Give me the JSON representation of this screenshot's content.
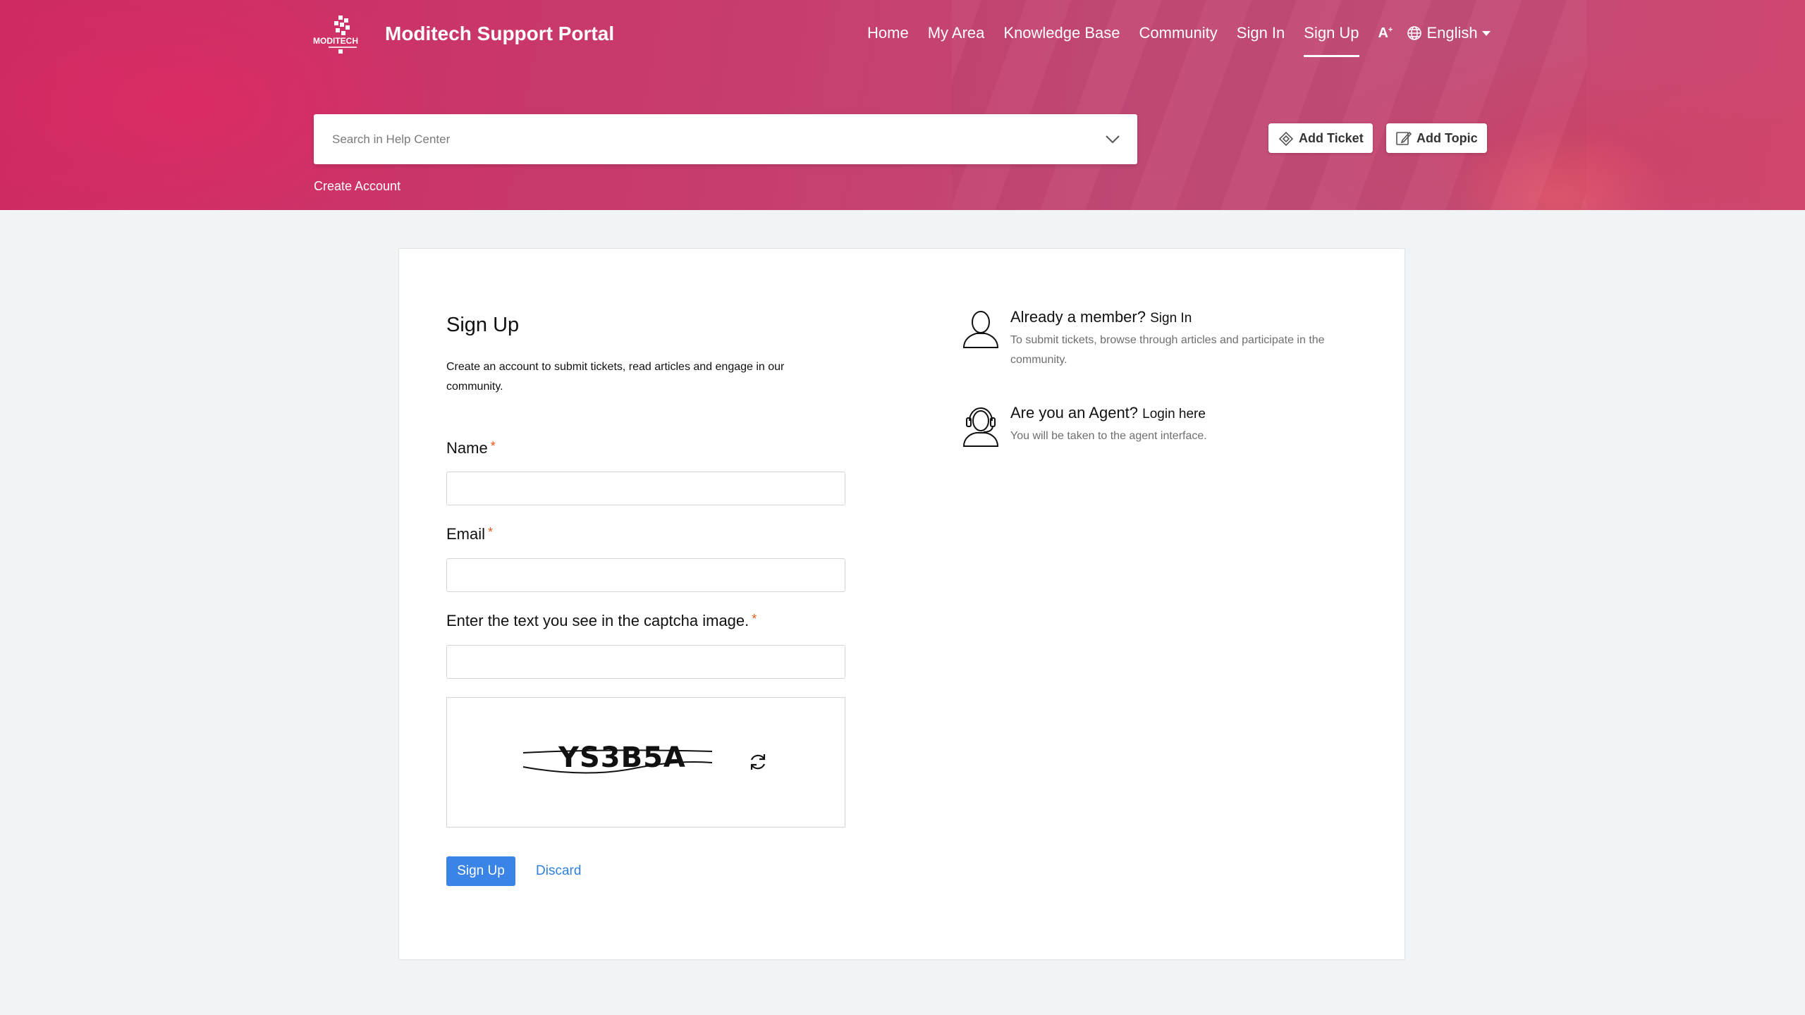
{
  "brand": {
    "title": "Moditech Support Portal",
    "logo_text": "MODITECH"
  },
  "nav": {
    "items": [
      {
        "label": "Home"
      },
      {
        "label": "My Area"
      },
      {
        "label": "Knowledge Base"
      },
      {
        "label": "Community"
      },
      {
        "label": "Sign In"
      },
      {
        "label": "Sign Up",
        "active": true
      }
    ],
    "font_icon": "A",
    "language": "English"
  },
  "search": {
    "placeholder": "Search in Help Center"
  },
  "actions": {
    "add_ticket": "Add Ticket",
    "add_topic": "Add Topic"
  },
  "create_account": "Create Account",
  "form": {
    "title": "Sign Up",
    "description": "Create an account to submit tickets, read articles and engage in our community.",
    "fields": [
      {
        "label": "Name",
        "required_mark": "*"
      },
      {
        "label": "Email",
        "required_mark": "*"
      },
      {
        "label": "Enter the text you see in the captcha image.",
        "required_mark": "*"
      }
    ],
    "captcha_text": "YS3B5A",
    "submit_label": "Sign Up",
    "discard_label": "Discard"
  },
  "info": {
    "member": {
      "title": "Already a member?",
      "link": "Sign In",
      "description": "To submit tickets, browse through articles and participate in the community."
    },
    "agent": {
      "title": "Are you an Agent?",
      "link": "Login here",
      "description": "You will be taken to the agent interface."
    }
  },
  "colors": {
    "header": "#c83a6c",
    "primary_button": "#3a84e8",
    "link": "#2f7fde",
    "required": "#e45a1d"
  }
}
